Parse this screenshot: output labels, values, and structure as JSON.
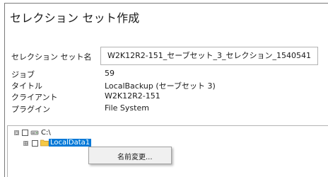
{
  "dialog": {
    "title": "セレクション セット作成"
  },
  "form": {
    "name_label": "セレクション セット名",
    "name_value": "W2K12R2-151_セーブセット_3_セレクション_1540541",
    "rows": [
      {
        "label": "ジョブ",
        "value": "59"
      },
      {
        "label": "タイトル",
        "value": "LocalBackup (セーブセット 3)"
      },
      {
        "label": "クライアント",
        "value": "W2K12R2-151"
      },
      {
        "label": "プラグイン",
        "value": "File System"
      }
    ]
  },
  "tree": {
    "root": {
      "expander": "⊟",
      "label": "C:\\",
      "icon": "drive-icon"
    },
    "child": {
      "expander": "⊞",
      "label": "LocalData1",
      "icon": "folder-icon",
      "selected": true
    }
  },
  "context_menu": {
    "items": [
      {
        "label": "名前変更..."
      }
    ]
  },
  "colors": {
    "selection": "#0078d7",
    "folder": "#f6c945",
    "menu_bg": "#f0f0f0"
  }
}
